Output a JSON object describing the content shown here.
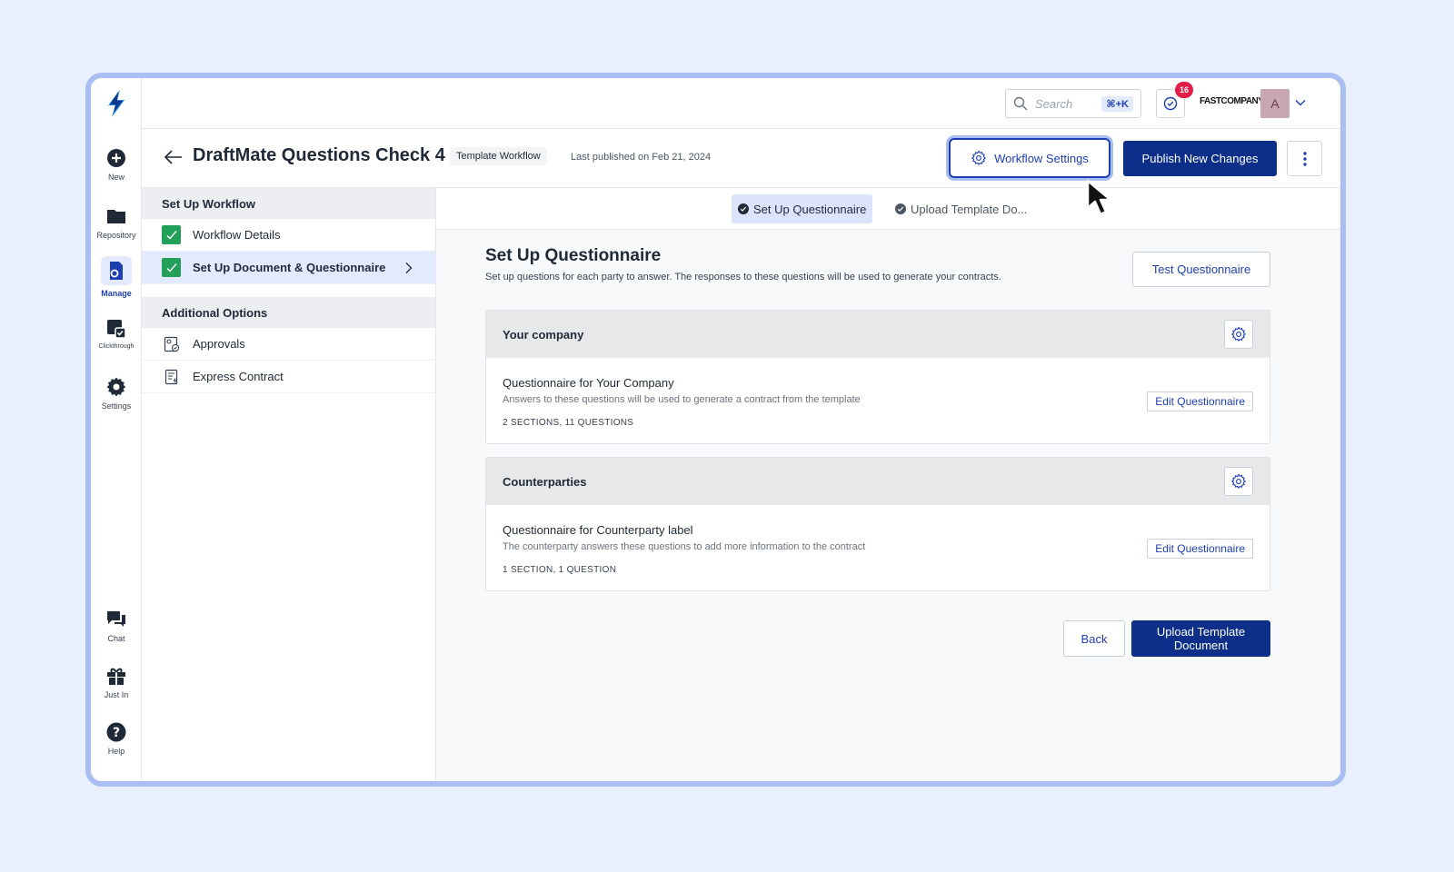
{
  "rail": {
    "items": [
      {
        "label": "New",
        "icon": "plus-circle-icon"
      },
      {
        "label": "Repository",
        "icon": "folder-icon"
      },
      {
        "label": "Manage",
        "icon": "manage-document-icon"
      },
      {
        "label": "Clickthrough",
        "icon": "clickthrough-icon"
      },
      {
        "label": "Settings",
        "icon": "gear-icon"
      },
      {
        "label": "Chat",
        "icon": "chat-icon"
      },
      {
        "label": "Just In",
        "icon": "gift-icon"
      },
      {
        "label": "Help",
        "icon": "help-icon"
      }
    ]
  },
  "topbar": {
    "search_placeholder": "Search",
    "search_shortcut": "⌘+K",
    "notification_count": "16",
    "company_name": "FASTCOMPANY",
    "avatar_initial": "A"
  },
  "header": {
    "title": "DraftMate Questions Check 4",
    "tag": "Template Workflow",
    "published": "Last published on Feb 21, 2024",
    "workflow_settings_label": "Workflow Settings",
    "publish_label": "Publish New Changes"
  },
  "sidenav": {
    "setup_heading": "Set Up Workflow",
    "setup_items": [
      {
        "label": "Workflow Details"
      },
      {
        "label": "Set Up Document & Questionnaire"
      }
    ],
    "additional_heading": "Additional Options",
    "additional_items": [
      {
        "label": "Approvals"
      },
      {
        "label": "Express Contract"
      }
    ]
  },
  "steps": [
    {
      "label": "Set Up Questionnaire"
    },
    {
      "label": "Upload Template Do..."
    }
  ],
  "main": {
    "title": "Set Up Questionnaire",
    "description": "Set up questions for each party to answer. The responses to these questions will be used to generate your contracts.",
    "test_label": "Test Questionnaire",
    "cards": [
      {
        "heading": "Your company",
        "title": "Questionnaire for Your Company",
        "description": "Answers to these questions will be used to generate a contract from the template",
        "meta": "2 SECTIONS, 11 QUESTIONS",
        "edit_label": "Edit Questionnaire"
      },
      {
        "heading": "Counterparties",
        "title": "Questionnaire for Counterparty label",
        "description": "The counterparty answers these questions to add more information to the contract",
        "meta": "1 SECTION, 1 QUESTION",
        "edit_label": "Edit Questionnaire"
      }
    ],
    "back_label": "Back",
    "upload_label": "Upload Template Document"
  },
  "colors": {
    "accent": "#1d3fb3",
    "primary_button": "#0d2f8a",
    "success": "#22a05a",
    "badge": "#e11d48"
  }
}
